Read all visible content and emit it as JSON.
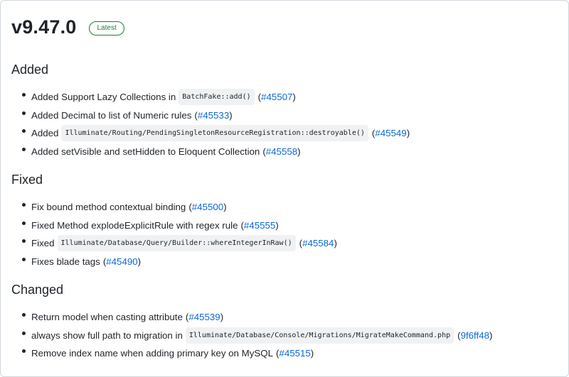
{
  "release": {
    "version": "v9.47.0",
    "badge": "Latest"
  },
  "sections": {
    "added": {
      "title": "Added",
      "items": [
        {
          "text": "Added Support Lazy Collections in",
          "code": "BatchFake::add()",
          "link": "#45507"
        },
        {
          "text": "Added Decimal to list of Numeric rules",
          "link": "#45533"
        },
        {
          "text": "Added",
          "code": "Illuminate/Routing/PendingSingletonResourceRegistration::destroyable()",
          "link": "#45549"
        },
        {
          "text": "Added setVisible and setHidden to Eloquent Collection",
          "link": "#45558"
        }
      ]
    },
    "fixed": {
      "title": "Fixed",
      "items": [
        {
          "text": "Fix bound method contextual binding",
          "link": "#45500"
        },
        {
          "text": "Fixed Method explodeExplicitRule with regex rule",
          "link": "#45555"
        },
        {
          "text": "Fixed",
          "code": "Illuminate/Database/Query/Builder::whereIntegerInRaw()",
          "link": "#45584"
        },
        {
          "text": "Fixes blade tags",
          "link": "#45490"
        }
      ]
    },
    "changed": {
      "title": "Changed",
      "items": [
        {
          "text": "Return model when casting attribute",
          "link": "#45539"
        },
        {
          "text": "always show full path to migration in",
          "code": "Illuminate/Database/Console/Migrations/MigrateMakeCommand.php",
          "link": "9f6ff48"
        },
        {
          "text": "Remove index name when adding primary key on MySQL",
          "link": "#45515"
        }
      ]
    }
  }
}
